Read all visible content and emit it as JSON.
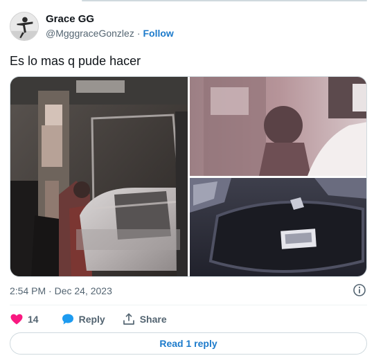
{
  "author": {
    "display_name": "Grace GG",
    "handle": "@MgggraceGonzlez",
    "separator": "·",
    "follow_label": "Follow"
  },
  "tweet": {
    "text": "Es lo mas q pude hacer",
    "timestamp": "2:54 PM · Dec 24, 2023"
  },
  "media": {
    "images": [
      {
        "description_icon": "photo-icon"
      },
      {
        "description_icon": "photo-icon"
      },
      {
        "description_icon": "photo-icon"
      }
    ]
  },
  "actions": {
    "like_count": "14",
    "reply_label": "Reply",
    "share_label": "Share"
  },
  "read_replies_label": "Read 1 reply",
  "colors": {
    "accent": "#1d7bcb",
    "heart": "#f91880",
    "reply_bubble": "#1d9bf0",
    "secondary_text": "#536471"
  }
}
